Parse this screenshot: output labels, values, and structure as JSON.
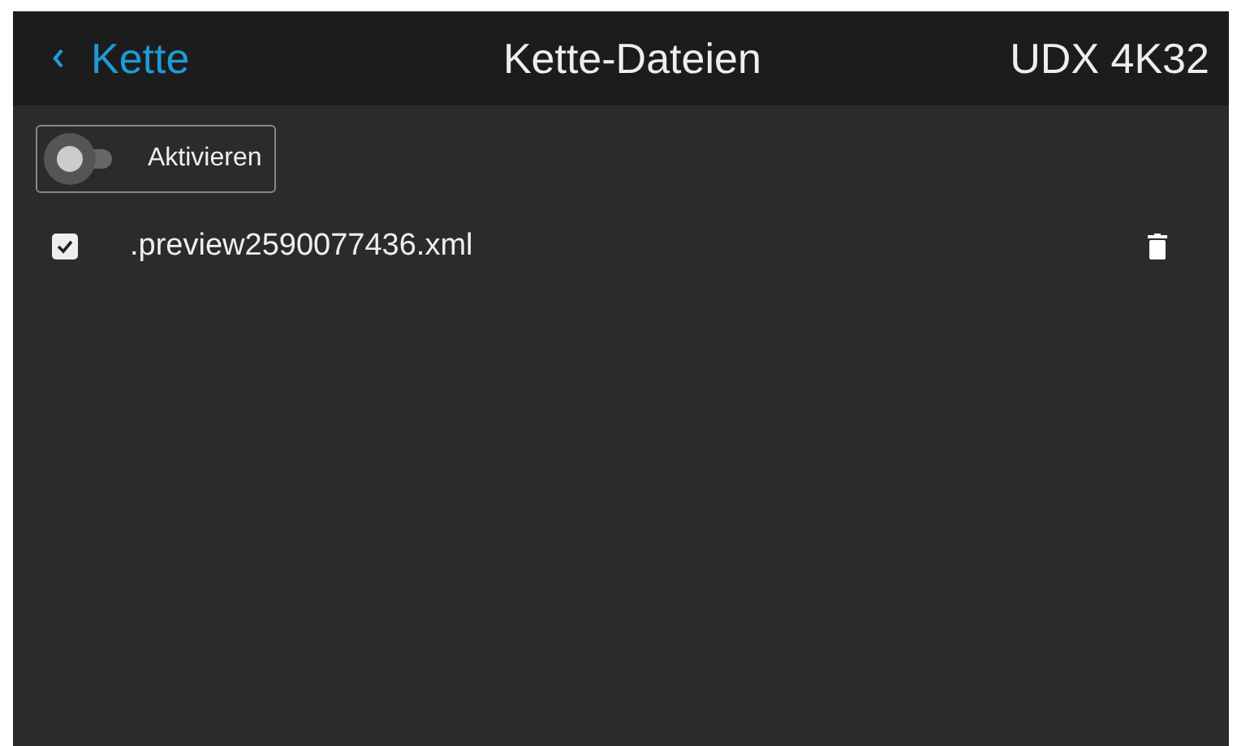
{
  "header": {
    "back_label": "Kette",
    "title": "Kette-Dateien",
    "device": "UDX 4K32"
  },
  "toggle": {
    "label": "Aktivieren",
    "on": false
  },
  "files": [
    {
      "name": ".preview2590077436.xml",
      "checked": true
    }
  ]
}
